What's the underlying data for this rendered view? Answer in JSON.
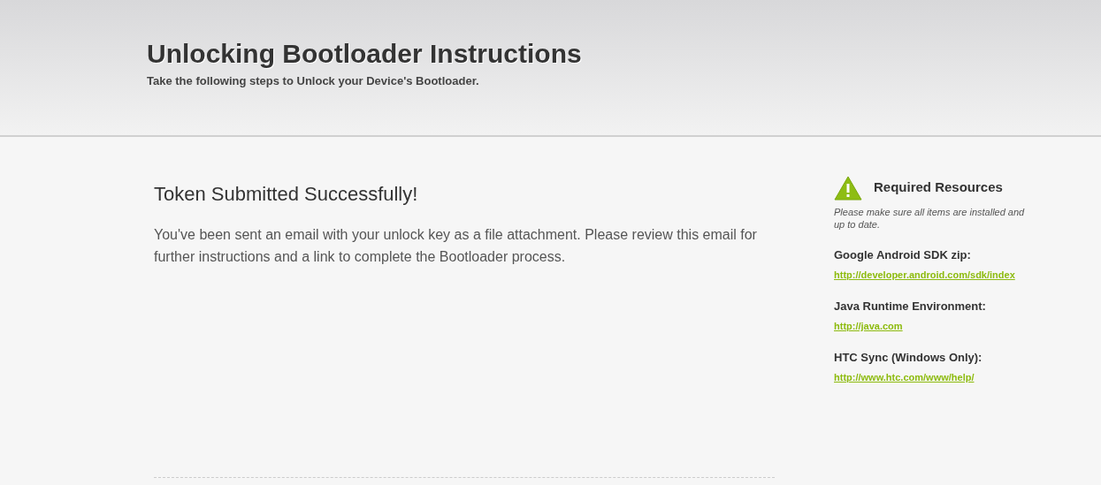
{
  "header": {
    "title": "Unlocking Bootloader Instructions",
    "subtitle": "Take the following steps to Unlock your Device's Bootloader."
  },
  "main": {
    "heading": "Token Submitted Successfully!",
    "body": "You've been sent an email with your unlock key as a file attachment. Please review this email for further instructions and a link to complete the Bootloader process."
  },
  "sidebar": {
    "title": "Required Resources",
    "note": "Please make sure all items are installed and up to date.",
    "resources": [
      {
        "label": "Google Android SDK zip:",
        "link": "http://developer.android.com/sdk/index"
      },
      {
        "label": "Java Runtime Environment:",
        "link": "http://java.com"
      },
      {
        "label": "HTC Sync (Windows Only):",
        "link": "http://www.htc.com/www/help/"
      }
    ]
  }
}
